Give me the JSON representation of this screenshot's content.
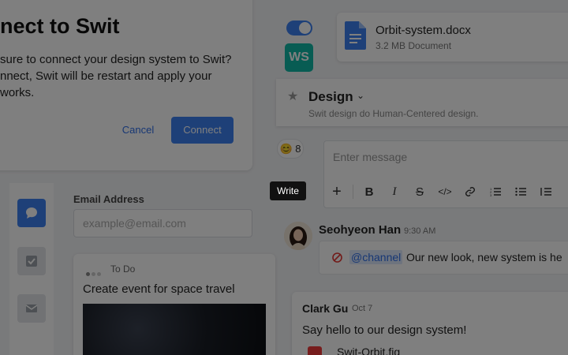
{
  "dialog": {
    "title": "nect to Swit",
    "body_line1": "sure to connect your design system to Swit?",
    "body_line2": "nnect, Swit will be restart and apply your",
    "body_line3": "works.",
    "cancel_label": "Cancel",
    "connect_label": "Connect"
  },
  "form": {
    "email_label": "Email Address",
    "email_placeholder": "example@email.com"
  },
  "todo": {
    "status": "To Do",
    "title": "Create event for space travel"
  },
  "workspace": {
    "badge": "WS",
    "badge_color": "#10b8a6",
    "toggle_on": true
  },
  "file": {
    "name": "Orbit-system.docx",
    "meta": "3.2 MB Document"
  },
  "channel": {
    "name": "Design",
    "description": "Swit design do Human-Centered design."
  },
  "reaction": {
    "emoji": "😊",
    "count": "8"
  },
  "composer": {
    "placeholder": "Enter message",
    "tools": [
      "plus-icon",
      "bold-icon",
      "italic-icon",
      "strike-icon",
      "code-icon",
      "link-icon",
      "ordered-list-icon",
      "bullet-list-icon",
      "indent-list-icon"
    ]
  },
  "tooltip": {
    "text": "Write"
  },
  "messages": [
    {
      "author": "Seohyeon Han",
      "time": "9:30 AM",
      "mention": "@channel",
      "text": "Our new look, new system is he"
    },
    {
      "author": "Clark Gu",
      "time": "Oct 7",
      "text": "Say hello to our design system!",
      "attachment": "Swit-Orbit.fig"
    }
  ],
  "colors": {
    "accent": "#3d80f0",
    "overlay": "rgba(0,0,0,0.5)"
  }
}
